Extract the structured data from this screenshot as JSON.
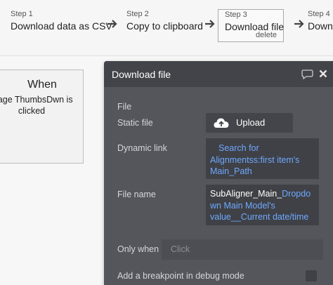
{
  "steps": [
    {
      "number": "Step 1",
      "title": "Download data as CSV"
    },
    {
      "number": "Step 2",
      "title": "Copy to clipboard"
    },
    {
      "number": "Step 3",
      "title": "Download file",
      "delete_label": "delete"
    },
    {
      "number": "Step 4",
      "title": "Downl"
    }
  ],
  "event": {
    "title": "When",
    "description_line1": "mage ThumbsDwn is",
    "description_line2": "clicked"
  },
  "editor": {
    "title": "Download file",
    "section": "File",
    "static_file_label": "Static file",
    "upload_label": "Upload",
    "dynamic_link_label": "Dynamic link",
    "dynamic_link_lines": [
      "Search for",
      "Alignmentss:first item's",
      "Main_Path"
    ],
    "file_name_label": "File name",
    "file_name_plain": "SubAligner_Main_",
    "file_name_dynamic": "Dropdown Main Model's value__Current date/time",
    "only_when_label": "Only when",
    "only_when_placeholder": "Click",
    "breakpoint_label": "Add a breakpoint in debug mode"
  },
  "icons": [
    "arrow-right-icon",
    "comment-icon",
    "close-icon",
    "cloud-upload-icon"
  ],
  "colors": {
    "panel": "#54565c",
    "header": "#424449",
    "link_blue": "#6fa8ff"
  }
}
